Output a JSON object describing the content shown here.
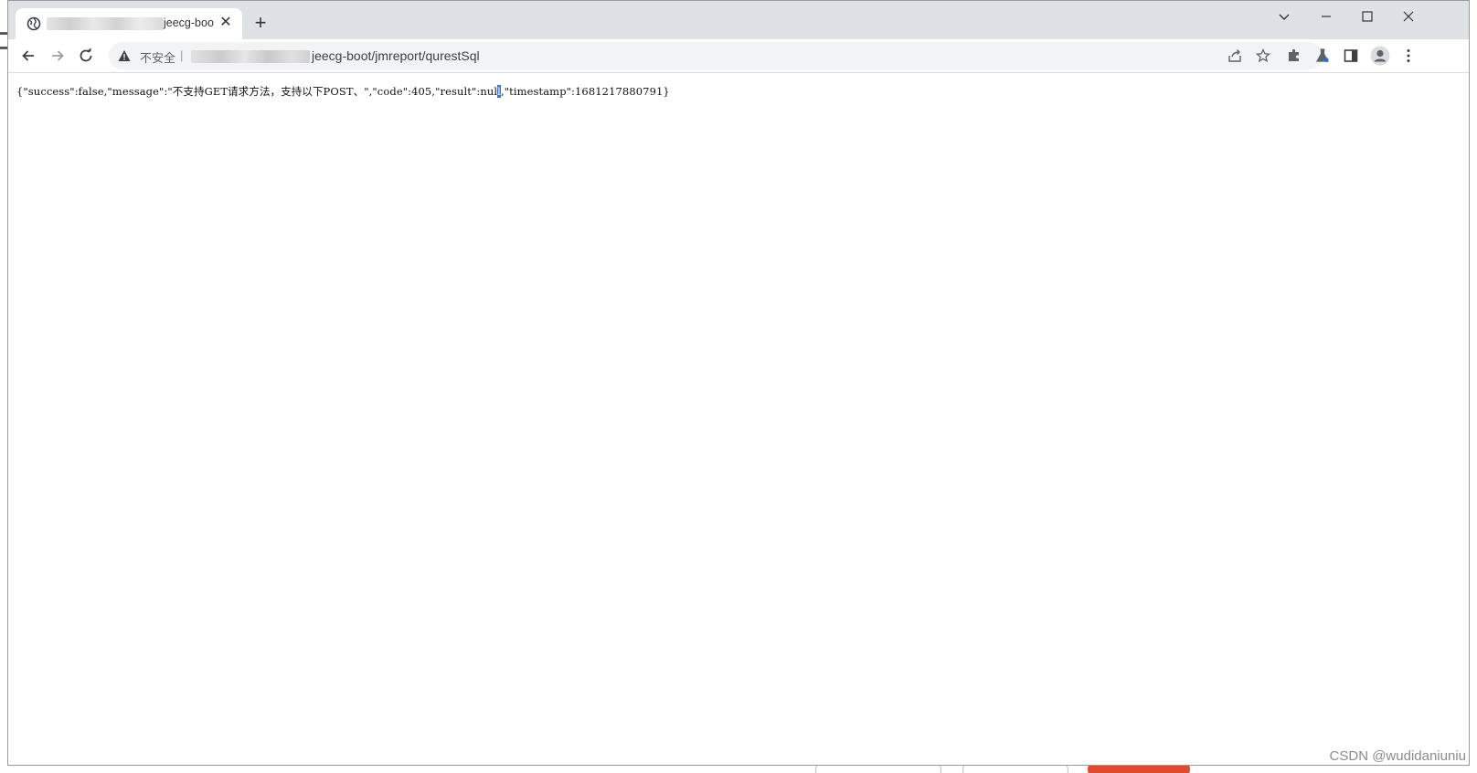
{
  "tab": {
    "title_suffix": "jeecg-boo",
    "close_glyph": "✕"
  },
  "tabstrip": {
    "new_tab_glyph": "+"
  },
  "toolbar": {
    "security_label": "不安全",
    "separator": "|",
    "url_path": "jeecg-boot/jmreport/qurestSql"
  },
  "page": {
    "json_before_selection": "{\"success\":false,\"message\":\"不支持GET请求方法，支持以下POST、\",\"code\":405,\"result\":nul",
    "json_selected": "l",
    "json_after_selection": ",\"timestamp\":1681217880791}"
  },
  "watermark": "CSDN @wudidaniuniu",
  "icons": {
    "favicon": "globe-icon",
    "back": "arrow-left-icon",
    "forward": "arrow-right-icon",
    "reload": "reload-icon",
    "warning": "warning-icon",
    "share": "share-icon",
    "bookmark": "star-icon",
    "extensions": "puzzle-icon",
    "labs": "flask-icon",
    "side_panel": "side-panel-icon",
    "profile": "avatar-icon",
    "menu": "kebab-menu-icon",
    "tab_search": "chevron-down-icon",
    "minimize": "minimize-icon",
    "maximize": "maximize-icon",
    "close": "close-icon"
  },
  "colors": {
    "tabstrip_bg": "#dee1e6",
    "omnibox_bg": "#f1f3f4",
    "selection": "#3874d8",
    "accent_red": "#e2492f"
  }
}
